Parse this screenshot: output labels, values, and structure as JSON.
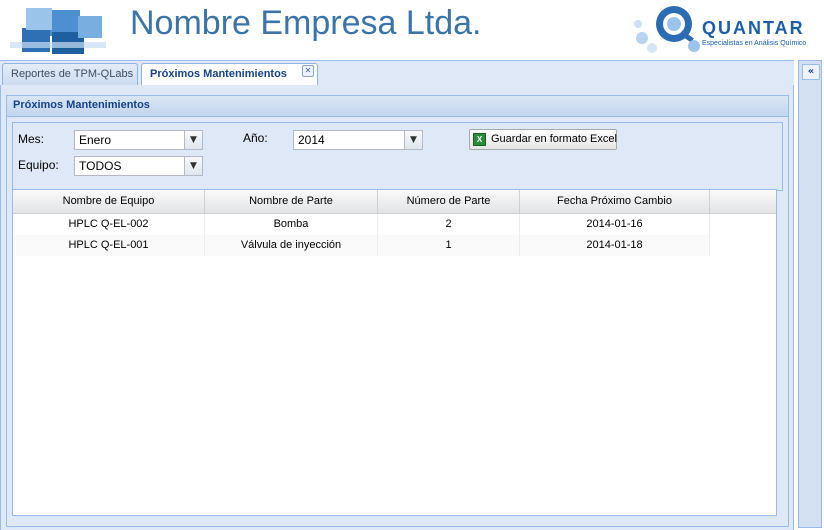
{
  "header": {
    "company_name": "Nombre Empresa Ltda.",
    "brand_word": "QUANTAR",
    "brand_tagline": "Especialistas en Análisis Químico"
  },
  "tabs": [
    {
      "label": "Reportes de TPM-QLabs",
      "active": false
    },
    {
      "label": "Próximos Mantenimientos",
      "active": true
    }
  ],
  "panel": {
    "title": "Próximos Mantenimientos"
  },
  "filters": {
    "mes_label": "Mes:",
    "mes_value": "Enero",
    "anio_label": "Año:",
    "anio_value": "2014",
    "equipo_label": "Equipo:",
    "equipo_value": "TODOS",
    "excel_button": "Guardar en formato Excel"
  },
  "grid": {
    "columns": [
      "Nombre de Equipo",
      "Nombre de Parte",
      "Número de Parte",
      "Fecha Próximo Cambio"
    ],
    "rows": [
      [
        "HPLC Q-EL-002",
        "Bomba",
        "2",
        "2014-01-16"
      ],
      [
        "HPLC Q-EL-001",
        "Válvula de inyección",
        "1",
        "2014-01-18"
      ]
    ]
  },
  "icons": {
    "collapse": "double-chevron-left-icon",
    "close_tab": "close-icon",
    "excel": "excel-icon",
    "dropdown": "chevron-down-icon"
  },
  "colors": {
    "title_blue": "#3a74a8",
    "panel_bg": "#dfe8f6",
    "panel_title": "#15428b"
  }
}
